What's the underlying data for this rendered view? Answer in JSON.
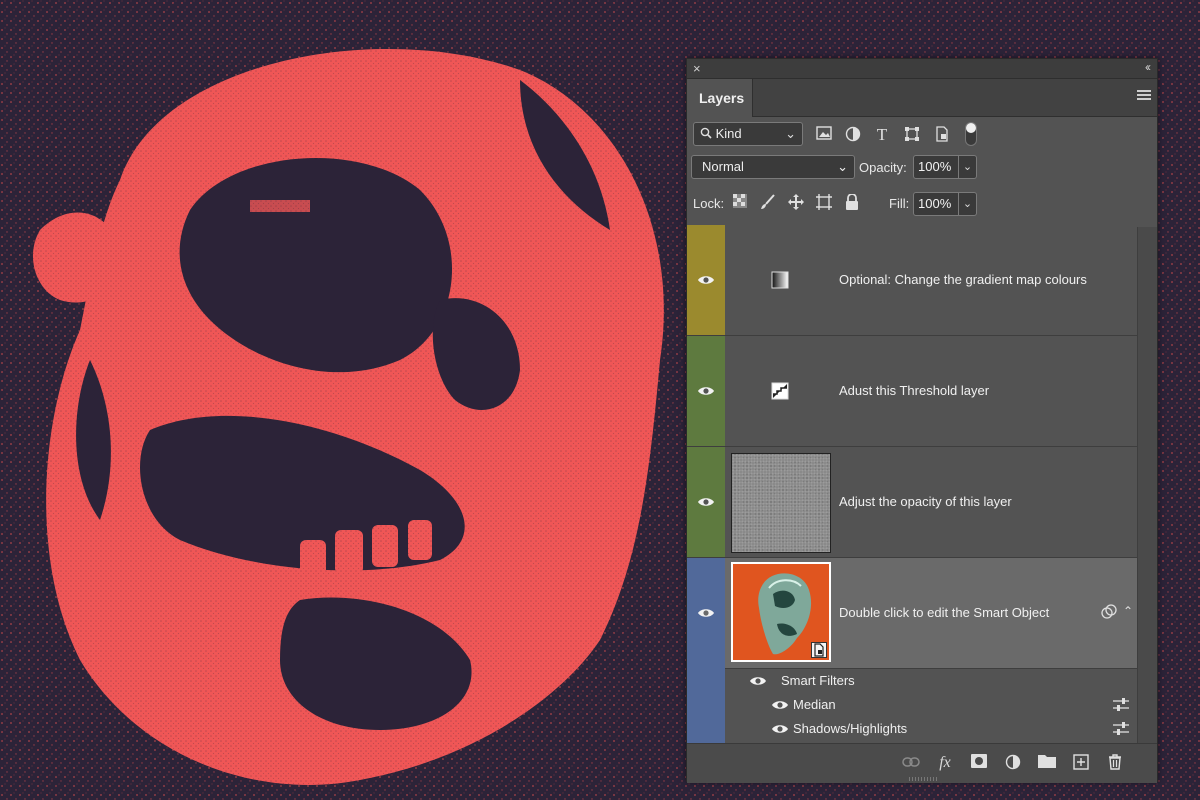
{
  "panel": {
    "close_glyph": "×",
    "collapse_glyph": "‹‹",
    "tab_label": "Layers",
    "menu_icon": "hamburger-icon"
  },
  "filter": {
    "kind_label": "Kind",
    "icons": [
      "image-filter-icon",
      "adjustment-filter-icon",
      "type-filter-icon",
      "shape-filter-icon",
      "smart-object-filter-icon"
    ]
  },
  "blend": {
    "mode": "Normal",
    "opacity_label": "Opacity:",
    "opacity_value": "100%"
  },
  "lock": {
    "label": "Lock:",
    "fill_label": "Fill:",
    "fill_value": "100%",
    "icons": [
      "lock-transparent-icon",
      "lock-image-icon",
      "lock-position-icon",
      "lock-artboard-icon",
      "lock-all-icon"
    ]
  },
  "layers": [
    {
      "name": "Optional: Change the gradient map colours",
      "color": "#9b8a2e",
      "type": "gradient-map"
    },
    {
      "name": "Adust this Threshold layer",
      "color": "#5e7a3f",
      "type": "threshold"
    },
    {
      "name": "Adjust the opacity of this layer",
      "color": "#5e7a3f",
      "type": "noise"
    },
    {
      "name": "Double click to edit the Smart Object",
      "color": "#51699a",
      "type": "smart-object",
      "selected": true
    }
  ],
  "smart_filters": {
    "label": "Smart Filters",
    "items": [
      "Median",
      "Shadows/Highlights"
    ]
  },
  "bottom_icons": [
    "link-icon",
    "fx-icon",
    "mask-icon",
    "adjustment-icon",
    "folder-icon",
    "new-layer-icon",
    "trash-icon"
  ],
  "colors": {
    "background": "#2c2338",
    "artwork_red": "#f05656",
    "panel": "#535353",
    "selected_row": "#6a6a6a"
  }
}
